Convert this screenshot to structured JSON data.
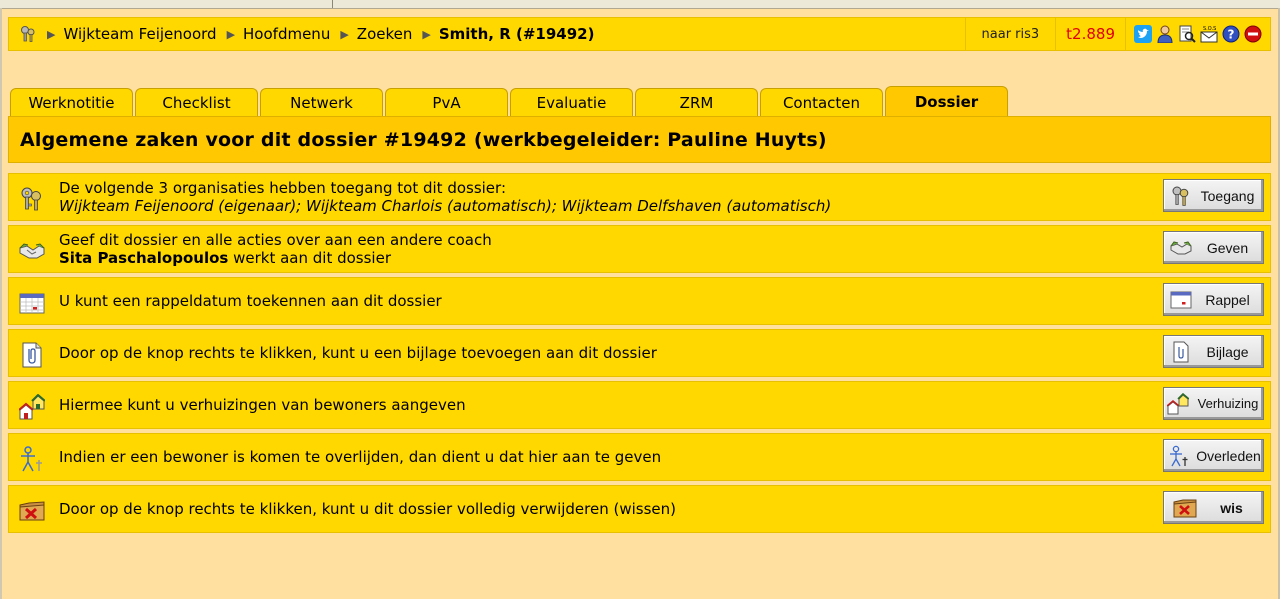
{
  "breadcrumb": {
    "items": [
      "Wijkteam Feijenoord",
      "Hoofdmenu",
      "Zoeken"
    ],
    "current": "Smith, R (#19492)"
  },
  "nav": {
    "ris_label": "naar ris3",
    "counter": "t2.889"
  },
  "tabs": [
    {
      "label": "Werknotitie",
      "active": false
    },
    {
      "label": "Checklist",
      "active": false
    },
    {
      "label": "Netwerk",
      "active": false
    },
    {
      "label": "PvA",
      "active": false
    },
    {
      "label": "Evaluatie",
      "active": false
    },
    {
      "label": "ZRM",
      "active": false
    },
    {
      "label": "Contacten",
      "active": false
    },
    {
      "label": "Dossier",
      "active": true
    }
  ],
  "header": {
    "title": "Algemene zaken voor dit dossier #19492  (werkbegeleider: Pauline Huyts)"
  },
  "rows": {
    "access": {
      "line1": "De volgende 3 organisaties hebben toegang tot dit dossier:",
      "line2": "Wijkteam Feijenoord (eigenaar);  Wijkteam Charlois (automatisch);  Wijkteam Delfshaven (automatisch)",
      "button": "Toegang"
    },
    "give": {
      "line1": "Geef dit dossier en alle acties over aan een andere coach",
      "coach": "Sita Paschalopoulos",
      "line2_rest": " werkt aan dit dossier",
      "button": "Geven"
    },
    "reminder": {
      "text": "U kunt een rappeldatum toekennen aan dit dossier",
      "button": "Rappel"
    },
    "attachment": {
      "text": "Door op de knop rechts te klikken, kunt u een bijlage toevoegen aan dit dossier",
      "button": "Bijlage"
    },
    "moving": {
      "text": "Hiermee kunt u verhuizingen van bewoners aangeven",
      "button": "Verhuizing"
    },
    "deceased": {
      "text": "Indien er een bewoner is komen te overlijden, dan dient u dat hier aan te geven",
      "button": "Overleden"
    },
    "delete": {
      "text": "Door op de knop rechts te klikken, kunt u dit dossier volledig verwijderen (wissen)",
      "button": "wis"
    }
  },
  "colors": {
    "background": "#ffe0a0",
    "bar": "#ffd800",
    "header": "#ffc800",
    "counter": "#e00000"
  }
}
